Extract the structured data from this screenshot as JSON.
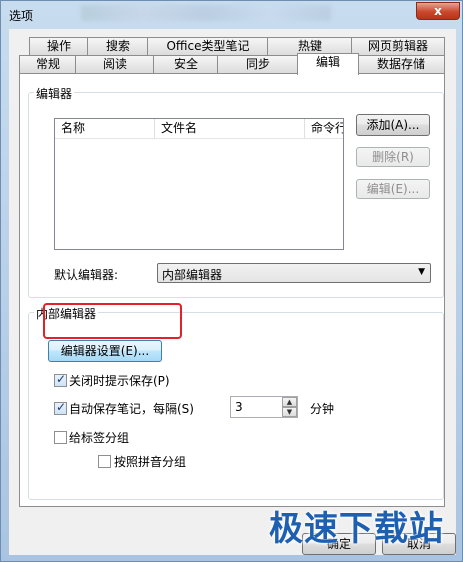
{
  "window": {
    "title": "选项",
    "close_glyph": "x"
  },
  "tabs_row1": [
    "操作",
    "搜索",
    "Office类型笔记",
    "热键",
    "网页剪辑器"
  ],
  "tabs_row2": [
    "常规",
    "阅读",
    "安全",
    "同步",
    "编辑",
    "数据存储"
  ],
  "active_tab": "编辑",
  "editors": {
    "group_label": "编辑器",
    "columns": [
      "名称",
      "文件名",
      "命令行"
    ],
    "add_button": "添加(A)...",
    "delete_button": "删除(R)",
    "edit_button": "编辑(E)...",
    "default_label": "默认编辑器:",
    "default_value": "内部编辑器"
  },
  "internal": {
    "group_label": "内部编辑器",
    "settings_button": "编辑器设置(E)...",
    "prompt_save_label": "关闭时提示保存(P)",
    "prompt_save_checked": true,
    "autosave_label": "自动保存笔记，每隔(S)",
    "autosave_checked": true,
    "autosave_interval": "3",
    "autosave_unit": "分钟",
    "group_tags_label": "给标签分组",
    "group_tags_checked": false,
    "pinyin_label": "按照拼音分组",
    "pinyin_checked": false
  },
  "footer": {
    "ok_button": "确定",
    "cancel_button": "取消"
  },
  "watermark": "极速下载站",
  "colors": {
    "highlight_box": "#e4202a",
    "watermark": "#1d5fb0"
  }
}
